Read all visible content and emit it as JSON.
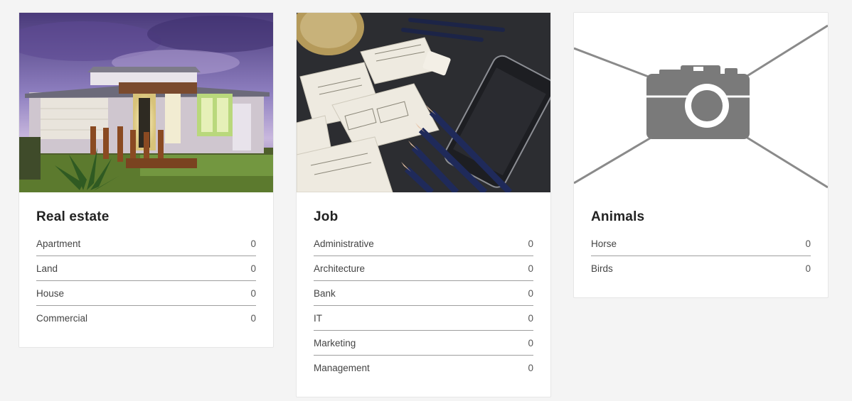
{
  "categories": [
    {
      "title": "Real estate",
      "image": "house-photo",
      "items": [
        {
          "label": "Apartment",
          "count": "0"
        },
        {
          "label": "Land",
          "count": "0"
        },
        {
          "label": "House",
          "count": "0"
        },
        {
          "label": "Commercial",
          "count": "0"
        }
      ]
    },
    {
      "title": "Job",
      "image": "desk-sketches-photo",
      "items": [
        {
          "label": "Administrative",
          "count": "0"
        },
        {
          "label": "Architecture",
          "count": "0"
        },
        {
          "label": "Bank",
          "count": "0"
        },
        {
          "label": "IT",
          "count": "0"
        },
        {
          "label": "Marketing",
          "count": "0"
        },
        {
          "label": "Management",
          "count": "0"
        }
      ]
    },
    {
      "title": "Animals",
      "image": "camera-placeholder-icon",
      "items": [
        {
          "label": "Horse",
          "count": "0"
        },
        {
          "label": "Birds",
          "count": "0"
        }
      ]
    }
  ],
  "colors": {
    "background": "#f4f4f4",
    "card": "#ffffff",
    "divider": "#9e9e9e",
    "placeholder_gray": "#7a7a7a"
  }
}
